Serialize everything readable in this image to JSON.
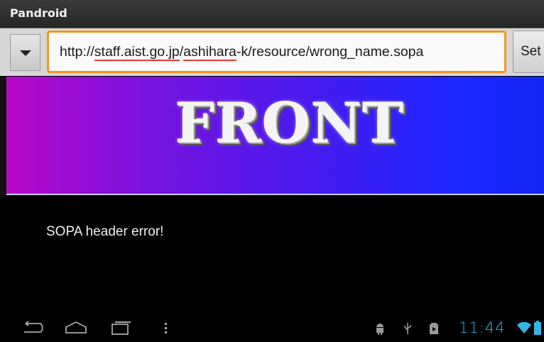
{
  "app": {
    "title": "Pandroid"
  },
  "toolbar": {
    "url_parts": [
      {
        "text": "http://",
        "misspelled": false
      },
      {
        "text": "staff.aist.go.jp",
        "misspelled": true
      },
      {
        "text": "/",
        "misspelled": false
      },
      {
        "text": "ashihara",
        "misspelled": true
      },
      {
        "text": "-k/resource/wrong_name.sopa",
        "misspelled": false
      }
    ],
    "set_label": "Set",
    "focus_color": "#f2971d"
  },
  "banner": {
    "logo_text": "FRONT",
    "gradient_start": "#b808c9",
    "gradient_end": "#1226f0"
  },
  "content": {
    "message": "SOPA header error!"
  },
  "nav": {
    "icons": [
      "back-icon",
      "home-icon",
      "recent-apps-icon",
      "menu-icon"
    ]
  },
  "status": {
    "icons": [
      "android-debug-icon",
      "usb-icon",
      "download-icon",
      "wifi-icon",
      "battery-icon"
    ],
    "time": "11:44",
    "accent": "#33b5e5"
  }
}
